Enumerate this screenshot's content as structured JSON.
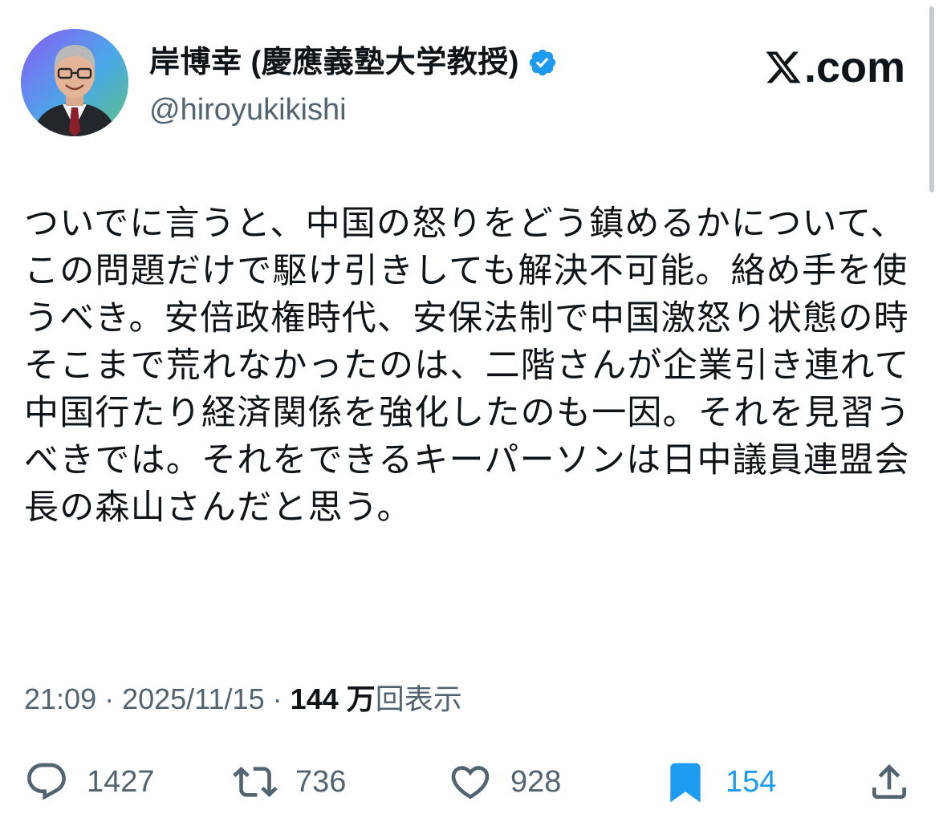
{
  "author": {
    "display_name": "岸博幸 (慶應義塾大学教授)",
    "handle": "@hiroyukikishi",
    "verified": true,
    "verified_color": "#1d9bf0"
  },
  "brand": {
    "logo_text": ".com",
    "logo_icon": "x-logo-icon"
  },
  "tweet": {
    "text": "ついでに言うと、中国の怒りをどう鎮めるかについて、この問題だけで駆け引きしても解決不可能。絡め手を使うべき。安倍政権時代、安保法制で中国激怒り状態の時そこまで荒れなかったのは、二階さんが企業引き連れて中国行たり経済関係を強化したのも一因。それを見習うべきでは。それをできるキーパーソンは日中議員連盟会長の森山さんだと思う。"
  },
  "meta": {
    "time": "21:09",
    "separator1": " · ",
    "date": "2025/11/15",
    "separator2": " · ",
    "views_count": "144 万",
    "views_label": "回表示"
  },
  "actions": {
    "reply": {
      "icon": "reply-icon",
      "count": "1427"
    },
    "repost": {
      "icon": "repost-icon",
      "count": "736"
    },
    "like": {
      "icon": "heart-icon",
      "count": "928"
    },
    "bookmark": {
      "icon": "bookmark-icon",
      "count": "154",
      "active": true
    },
    "share": {
      "icon": "share-icon"
    }
  },
  "colors": {
    "text_primary": "#0f1419",
    "text_secondary": "#536471",
    "accent": "#1d9bf0"
  }
}
